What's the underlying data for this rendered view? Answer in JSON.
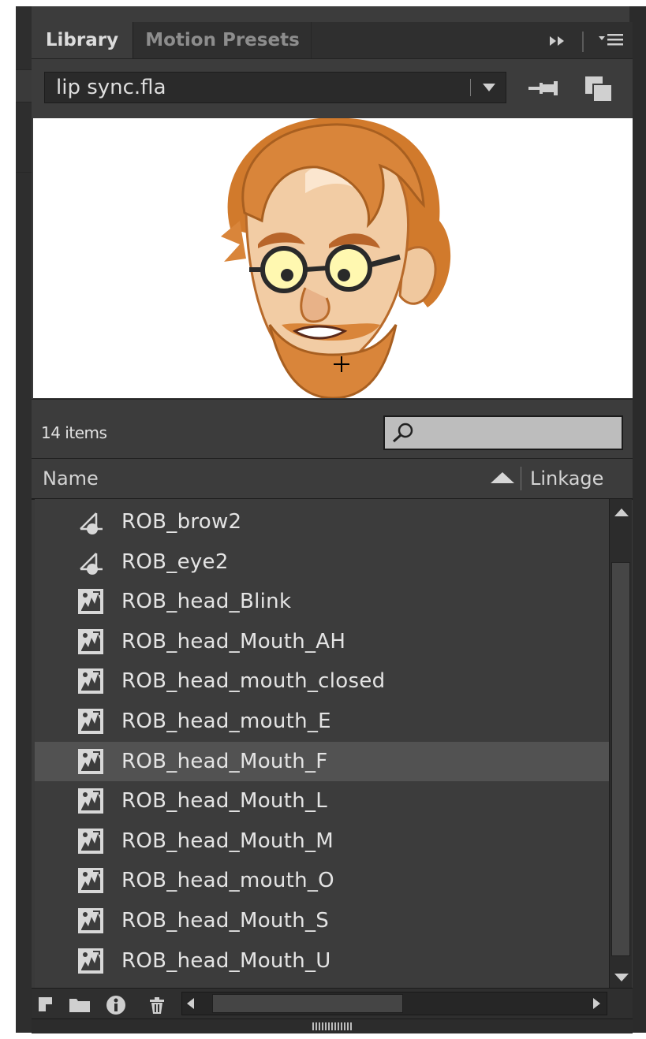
{
  "tabs": [
    {
      "label": "Library",
      "active": true
    },
    {
      "label": "Motion Presets",
      "active": false
    }
  ],
  "panel_controls": {
    "expand_icon": "double-chevron-right-icon",
    "menu_icon": "panel-menu-icon"
  },
  "file_selector": {
    "value": "lip sync.fla"
  },
  "preview": {
    "alt": "ROB head symbol preview"
  },
  "status": {
    "item_count": "14 items"
  },
  "search": {
    "placeholder": ""
  },
  "columns": {
    "name": "Name",
    "linkage": "Linkage"
  },
  "items": [
    {
      "name": "ROB_brow2",
      "type": "graphic",
      "selected": false
    },
    {
      "name": "ROB_eye2",
      "type": "graphic",
      "selected": false
    },
    {
      "name": "ROB_head_Blink",
      "type": "movieclip",
      "selected": false
    },
    {
      "name": "ROB_head_Mouth_AH",
      "type": "movieclip",
      "selected": false
    },
    {
      "name": "ROB_head_mouth_closed",
      "type": "movieclip",
      "selected": false
    },
    {
      "name": "ROB_head_mouth_E",
      "type": "movieclip",
      "selected": false
    },
    {
      "name": "ROB_head_Mouth_F",
      "type": "movieclip",
      "selected": true
    },
    {
      "name": "ROB_head_Mouth_L",
      "type": "movieclip",
      "selected": false
    },
    {
      "name": "ROB_head_Mouth_M",
      "type": "movieclip",
      "selected": false
    },
    {
      "name": "ROB_head_mouth_O",
      "type": "movieclip",
      "selected": false
    },
    {
      "name": "ROB_head_Mouth_S",
      "type": "movieclip",
      "selected": false
    },
    {
      "name": "ROB_head_Mouth_U",
      "type": "movieclip",
      "selected": false
    }
  ],
  "toolbar_icons": [
    "new-symbol-icon",
    "new-folder-icon",
    "properties-icon",
    "delete-icon"
  ],
  "colors": {
    "panel_bg": "#3a3a3a",
    "selected_row": "#525252",
    "text": "#e4e4e4"
  }
}
